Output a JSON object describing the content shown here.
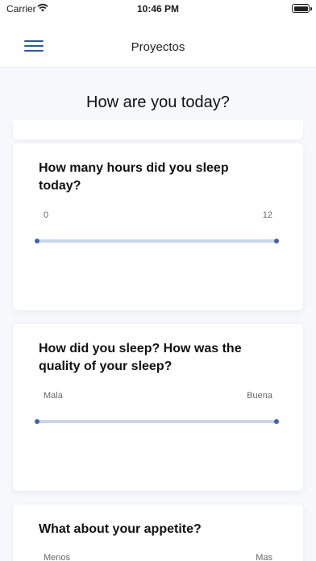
{
  "status_bar": {
    "carrier": "Carrier",
    "time": "10:46 PM"
  },
  "nav": {
    "title": "Proyectos"
  },
  "page": {
    "title": "How are you today?"
  },
  "questions": [
    {
      "text": "How many hours did you sleep today?",
      "min_label": "0",
      "max_label": "12"
    },
    {
      "text": "How did you sleep? How was the quality of your sleep?",
      "min_label": "Mala",
      "max_label": "Buena"
    },
    {
      "text": "What about your appetite?",
      "min_label": "Menos",
      "max_label": "Mas"
    }
  ],
  "colors": {
    "accent": "#3a65ac",
    "track": "#c9d5ea",
    "background": "#f7f8fb"
  }
}
